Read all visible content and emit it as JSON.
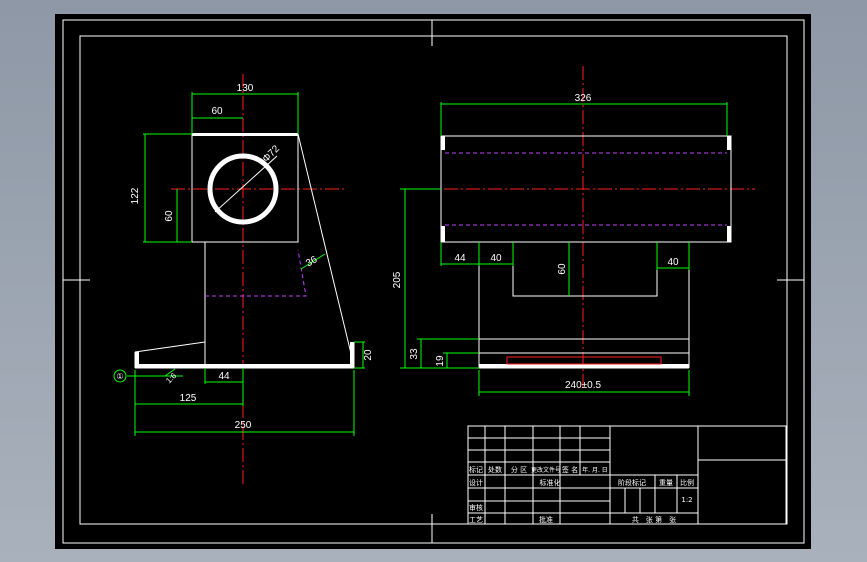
{
  "colors": {
    "background": "#000000",
    "outline": "#ffffff",
    "dimension": "#00ff00",
    "centerline": "#ff2020",
    "hidden": "#c040ff"
  },
  "front_view": {
    "dims": {
      "width_130": "130",
      "half_60": "60",
      "height_122": "122",
      "height_60": "60",
      "dia_72": "Φ72",
      "angle_36": "36",
      "base_thk_20": "20",
      "slope_1_6": "1:6",
      "offset_44": "44",
      "span_125": "125",
      "base_250": "250"
    },
    "datum_label": "①"
  },
  "side_view": {
    "dims": {
      "length_326": "326",
      "d44": "44",
      "d40_left": "40",
      "d40_right": "40",
      "d60": "60",
      "height_205": "205",
      "d33": "33",
      "d19": "19",
      "base_tol": "240±0.5"
    }
  },
  "title_block": {
    "header": [
      "标记",
      "处数",
      "分 区",
      "更改文件号",
      "签 名",
      "年. 月. 日"
    ],
    "design": "设计",
    "standardize": "标准化",
    "review": "审核",
    "process": "工艺",
    "approve": "批准",
    "stage_mark": "阶段标记",
    "weight": "重量",
    "scale_label": "比例",
    "scale_value": "1:2",
    "sheets": "共　张 第　张"
  }
}
